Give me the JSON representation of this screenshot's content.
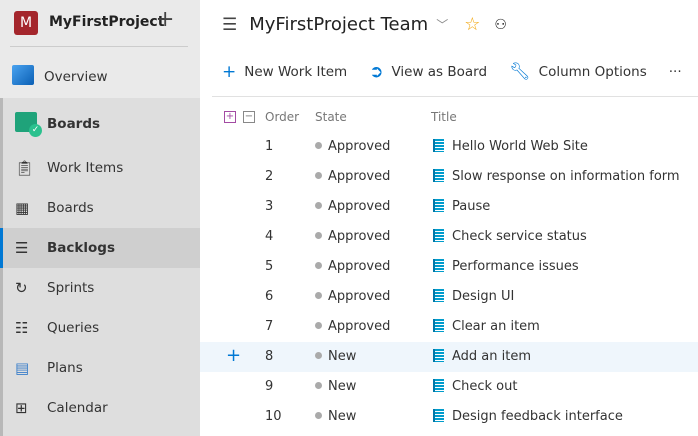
{
  "project": {
    "initial": "M",
    "name": "MyFirstProject"
  },
  "nav": {
    "overview": "Overview",
    "boards_hub": "Boards",
    "items": [
      {
        "label": "Work Items",
        "icon": "clipboard-icon"
      },
      {
        "label": "Boards",
        "icon": "board-grid-icon"
      },
      {
        "label": "Backlogs",
        "icon": "backlog-icon",
        "selected": true
      },
      {
        "label": "Sprints",
        "icon": "sprint-icon"
      },
      {
        "label": "Queries",
        "icon": "query-filter-icon"
      },
      {
        "label": "Plans",
        "icon": "plans-icon"
      },
      {
        "label": "Calendar",
        "icon": "calendar-icon"
      }
    ]
  },
  "header": {
    "title": "MyFirstProject Team"
  },
  "toolbar": {
    "new": "New Work Item",
    "board": "View as Board",
    "columns": "Column Options",
    "more": "···"
  },
  "columns": {
    "order": "Order",
    "state": "State",
    "title": "Title"
  },
  "rows": [
    {
      "order": "1",
      "state": "Approved",
      "title": "Hello World Web Site"
    },
    {
      "order": "2",
      "state": "Approved",
      "title": "Slow response on information form"
    },
    {
      "order": "3",
      "state": "Approved",
      "title": "Pause"
    },
    {
      "order": "4",
      "state": "Approved",
      "title": "Check service status"
    },
    {
      "order": "5",
      "state": "Approved",
      "title": "Performance issues"
    },
    {
      "order": "6",
      "state": "Approved",
      "title": "Design UI"
    },
    {
      "order": "7",
      "state": "Approved",
      "title": "Clear an item"
    },
    {
      "order": "8",
      "state": "New",
      "title": "Add an item"
    },
    {
      "order": "9",
      "state": "New",
      "title": "Check out"
    },
    {
      "order": "10",
      "state": "New",
      "title": "Design feedback interface"
    }
  ]
}
